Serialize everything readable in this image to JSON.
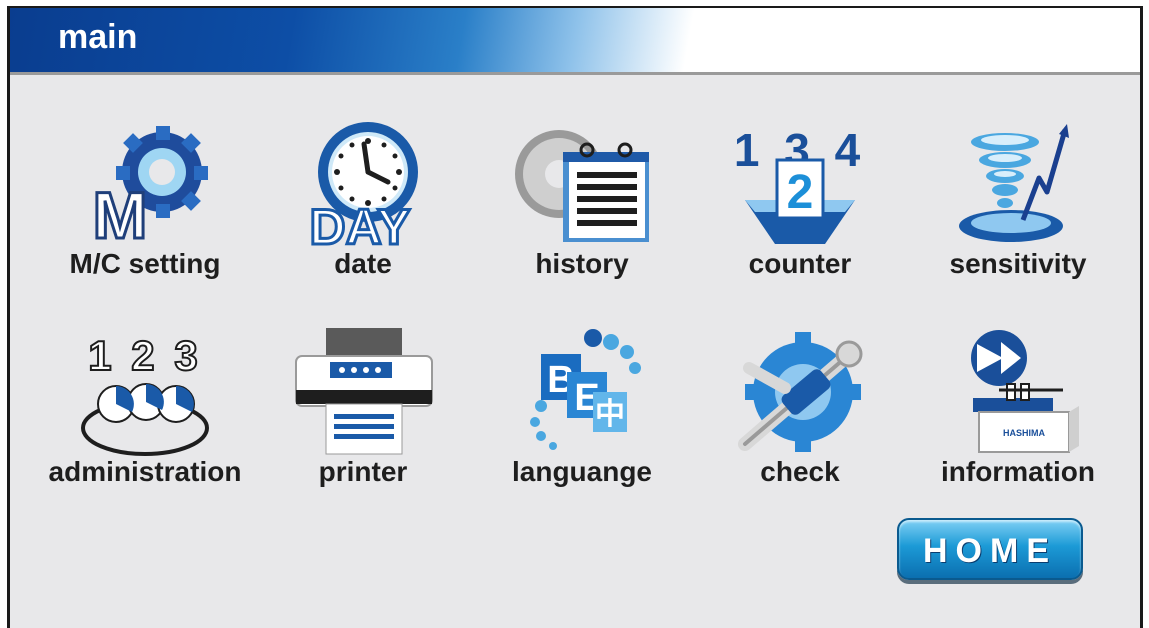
{
  "header": {
    "title": "main"
  },
  "tiles": [
    {
      "label": "M/C setting",
      "icon": "mc-setting-gear-icon"
    },
    {
      "label": "date",
      "icon": "clock-day-icon"
    },
    {
      "label": "history",
      "icon": "calendar-history-icon"
    },
    {
      "label": "counter",
      "icon": "counter-digits-icon"
    },
    {
      "label": "sensitivity",
      "icon": "sensitivity-tornado-icon"
    },
    {
      "label": "administration",
      "icon": "administration-users-icon"
    },
    {
      "label": "printer",
      "icon": "printer-icon"
    },
    {
      "label": "languange",
      "icon": "language-characters-icon"
    },
    {
      "label": "check",
      "icon": "wrench-gear-icon"
    },
    {
      "label": "information",
      "icon": "hashima-machine-icon"
    }
  ],
  "icon_texts": {
    "mc_letter": "M",
    "day_text": "DAY",
    "counter_front": "2",
    "counter_back": "1 3 4",
    "machine_brand": "HASHIMA",
    "admin_digits": "1 2 3"
  },
  "home_button": {
    "label": "HOME"
  },
  "colors": {
    "accent": "#1c9ad6",
    "title_bar": "#0d4ea6"
  }
}
